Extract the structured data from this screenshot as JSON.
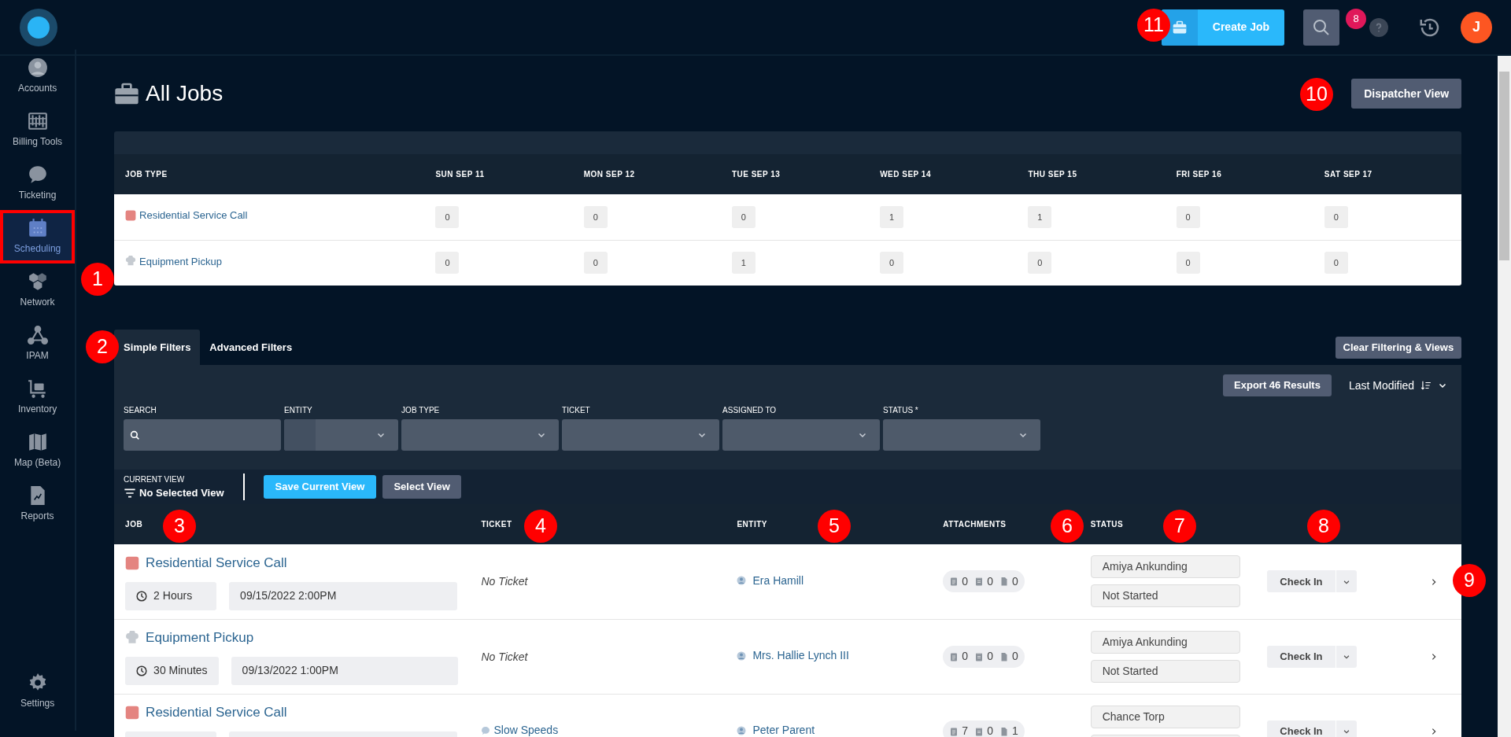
{
  "sidebar": {
    "items": [
      {
        "label": "Accounts",
        "selected": false,
        "highlighted": false
      },
      {
        "label": "Billing Tools",
        "selected": false,
        "highlighted": false
      },
      {
        "label": "Ticketing",
        "selected": false,
        "highlighted": false
      },
      {
        "label": "Scheduling",
        "selected": true,
        "highlighted": true
      },
      {
        "label": "Network",
        "selected": false,
        "highlighted": false
      },
      {
        "label": "IPAM",
        "selected": false,
        "highlighted": false
      },
      {
        "label": "Inventory",
        "selected": false,
        "highlighted": false
      },
      {
        "label": "Map (Beta)",
        "selected": false,
        "highlighted": false
      },
      {
        "label": "Reports",
        "selected": false,
        "highlighted": false
      }
    ],
    "settings": "Settings"
  },
  "topbar": {
    "create_button": "Create Job",
    "help_badge": "8",
    "avatar": "J"
  },
  "page": {
    "title": "All Jobs",
    "dispatcher_button": "Dispatcher View"
  },
  "summary": {
    "columns": [
      "JOB TYPE",
      "SUN SEP 11",
      "MON SEP 12",
      "TUE SEP 13",
      "WED SEP 14",
      "THU SEP 15",
      "FRI SEP 16",
      "SAT SEP 17"
    ],
    "rows": [
      {
        "kind": "service",
        "job_type": "Residential Service Call",
        "counts": [
          "0",
          "0",
          "0",
          "1",
          "1",
          "0",
          "0"
        ]
      },
      {
        "kind": "pickup",
        "job_type": "Equipment Pickup",
        "counts": [
          "0",
          "0",
          "1",
          "0",
          "0",
          "0",
          "0"
        ]
      }
    ]
  },
  "filters": {
    "tabs": [
      {
        "label": "Simple Filters",
        "selected": true
      },
      {
        "label": "Advanced Filters",
        "selected": false
      }
    ],
    "clear_button": "Clear Filtering & Views",
    "export_button": "Export 46 Results",
    "sort": "Last Modified",
    "fields": [
      {
        "label": "SEARCH",
        "kind": "search"
      },
      {
        "label": "ENTITY",
        "kind": "split"
      },
      {
        "label": "JOB TYPE",
        "kind": "select"
      },
      {
        "label": "TICKET",
        "kind": "select"
      },
      {
        "label": "ASSIGNED TO",
        "kind": "select"
      },
      {
        "label": "STATUS *",
        "kind": "select"
      }
    ],
    "current_view_label": "CURRENT VIEW",
    "current_view": "No Selected View",
    "save_button": "Save Current View",
    "select_button": "Select View"
  },
  "jobs": {
    "columns": [
      "JOB",
      "TICKET",
      "ENTITY",
      "ATTACHMENTS",
      "STATUS"
    ],
    "rows": [
      {
        "kind": "service",
        "title": "Residential Service Call",
        "duration": "2 Hours",
        "scheduled": "09/15/2022 2:00PM",
        "ticket_linked": false,
        "ticket": "No Ticket",
        "entity": "Era Hamill",
        "attachments": [
          "0",
          "0",
          "0"
        ],
        "assignee": "Amiya Ankunding",
        "status": "Not Started",
        "action": "Check In"
      },
      {
        "kind": "pickup",
        "title": "Equipment Pickup",
        "duration": "30 Minutes",
        "scheduled": "09/13/2022 1:00PM",
        "ticket_linked": false,
        "ticket": "No Ticket",
        "entity": "Mrs. Hallie Lynch III",
        "attachments": [
          "0",
          "0",
          "0"
        ],
        "assignee": "Amiya Ankunding",
        "status": "Not Started",
        "action": "Check In"
      },
      {
        "kind": "service",
        "title": "Residential Service Call",
        "ticket_linked": true,
        "ticket": "Slow Speeds",
        "entity": "Peter Parent",
        "attachments": [
          "7",
          "0",
          "1"
        ],
        "assignee": "Chance Torp",
        "action": "Check In"
      }
    ]
  },
  "callouts": [
    {
      "label": "11"
    },
    {
      "label": "10"
    },
    {
      "label": "1"
    },
    {
      "label": "2"
    },
    {
      "label": "3"
    },
    {
      "label": "4"
    },
    {
      "label": "5"
    },
    {
      "label": "6"
    },
    {
      "label": "7"
    },
    {
      "label": "8"
    },
    {
      "label": "9"
    }
  ]
}
